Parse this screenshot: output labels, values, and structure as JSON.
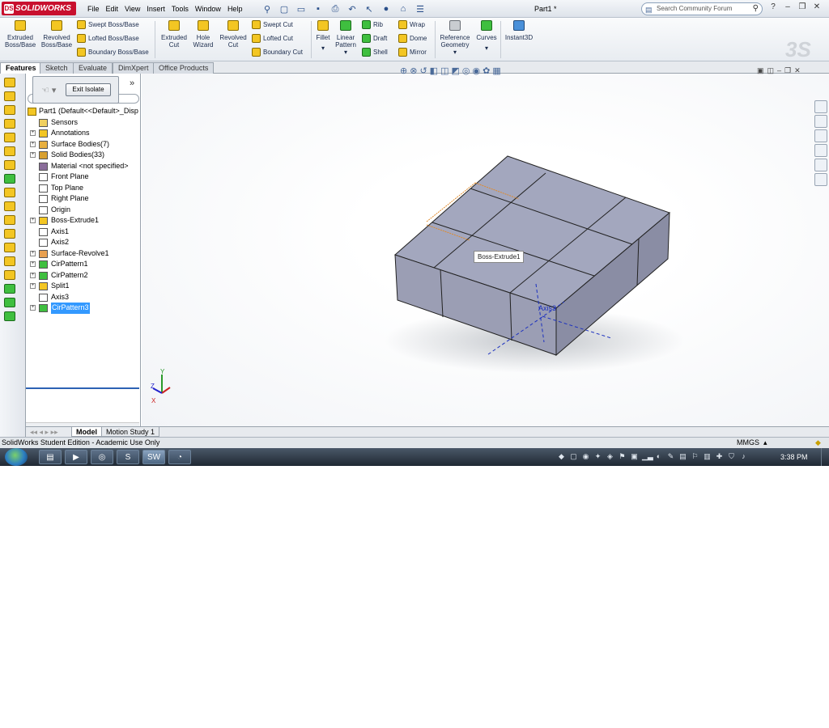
{
  "titlebar": {
    "app_name": "SOLIDWORKS",
    "menus": [
      "File",
      "Edit",
      "View",
      "Insert",
      "Tools",
      "Window",
      "Help"
    ],
    "doc_title": "Part1 *",
    "search_placeholder": "Search Community Forum"
  },
  "command_manager": {
    "extruded_boss": "Extruded\nBoss/Base",
    "revolved_boss": "Revolved\nBoss/Base",
    "swept_boss": "Swept Boss/Base",
    "lofted_boss": "Lofted Boss/Base",
    "boundary_boss": "Boundary Boss/Base",
    "extruded_cut": "Extruded\nCut",
    "hole_wizard": "Hole\nWizard",
    "revolved_cut": "Revolved\nCut",
    "swept_cut": "Swept Cut",
    "lofted_cut": "Lofted Cut",
    "boundary_cut": "Boundary Cut",
    "fillet": "Fillet",
    "linear_pattern": "Linear\nPattern",
    "rib": "Rib",
    "draft": "Draft",
    "shell": "Shell",
    "wrap": "Wrap",
    "dome": "Dome",
    "mirror": "Mirror",
    "reference_geometry": "Reference\nGeometry",
    "curves": "Curves",
    "instant3d": "Instant3D"
  },
  "tabs": [
    "Features",
    "Sketch",
    "Evaluate",
    "DimXpert",
    "Office Products"
  ],
  "feature_manager": {
    "exit_isolate": "Exit Isolate",
    "root": "Part1  (Default<<Default>_Disp",
    "items": [
      {
        "label": "Sensors",
        "expandable": false
      },
      {
        "label": "Annotations",
        "expandable": true
      },
      {
        "label": "Surface Bodies(7)",
        "expandable": true
      },
      {
        "label": "Solid Bodies(33)",
        "expandable": true
      },
      {
        "label": "Material <not specified>",
        "expandable": false
      },
      {
        "label": "Front Plane",
        "expandable": false
      },
      {
        "label": "Top Plane",
        "expandable": false
      },
      {
        "label": "Right Plane",
        "expandable": false
      },
      {
        "label": "Origin",
        "expandable": false
      },
      {
        "label": "Boss-Extrude1",
        "expandable": true
      },
      {
        "label": "Axis1",
        "expandable": false
      },
      {
        "label": "Axis2",
        "expandable": false
      },
      {
        "label": "Surface-Revolve1",
        "expandable": true
      },
      {
        "label": "CirPattern1",
        "expandable": true
      },
      {
        "label": "CirPattern2",
        "expandable": true
      },
      {
        "label": "Split1",
        "expandable": true
      },
      {
        "label": "Axis3",
        "expandable": false
      },
      {
        "label": "CirPattern3",
        "expandable": true
      }
    ]
  },
  "viewport": {
    "tooltip": "Boss-Extrude1",
    "axis_label": "Axis3",
    "triad_x": "X",
    "triad_y": "Y",
    "triad_z": "Z"
  },
  "bottom_tabs": [
    "Model",
    "Motion Study 1"
  ],
  "statusbar": {
    "left": "SolidWorks Student Edition - Academic Use Only",
    "units": "MMGS"
  },
  "taskbar": {
    "clock": "3:38 PM"
  }
}
